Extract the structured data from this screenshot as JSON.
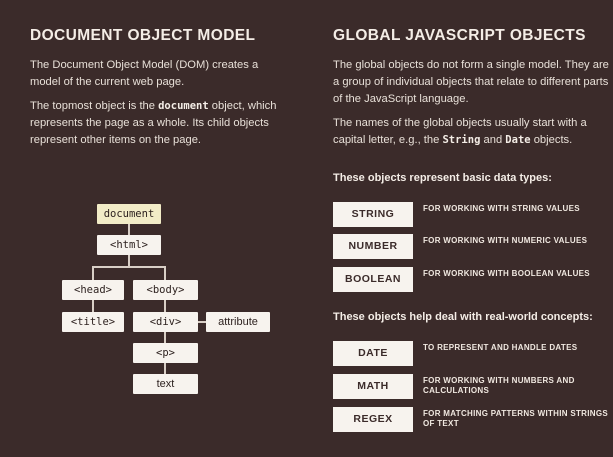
{
  "left": {
    "heading": "DOCUMENT OBJECT MODEL",
    "para1": "The Document Object Model (DOM) creates a model of the current web page.",
    "para2_a": "The topmost object is the ",
    "para2_code": "document",
    "para2_b": " object, which represents the page as a whole. Its child objects represent other items on the page.",
    "tree": {
      "document": "document",
      "html": "<html>",
      "head": "<head>",
      "body": "<body>",
      "title": "<title>",
      "div": "<div>",
      "attribute": "attribute",
      "p": "<p>",
      "text": "text"
    }
  },
  "right": {
    "heading": "GLOBAL JAVASCRIPT OBJECTS",
    "para1": "The global objects do not form a single model. They are a group of individual objects that relate to different parts of the JavaScript language.",
    "para2_a": "The names of the global objects usually start with a capital letter, e.g., the ",
    "para2_code1": "String",
    "para2_mid": " and ",
    "para2_code2": "Date",
    "para2_b": " objects.",
    "basic_heading": "These objects represent basic data types:",
    "basic": [
      {
        "name": "STRING",
        "desc": "FOR WORKING WITH STRING VALUES"
      },
      {
        "name": "NUMBER",
        "desc": "FOR WORKING WITH NUMERIC VALUES"
      },
      {
        "name": "BOOLEAN",
        "desc": "FOR WORKING WITH BOOLEAN VALUES"
      }
    ],
    "real_heading": "These objects help deal with real-world concepts:",
    "real": [
      {
        "name": "DATE",
        "desc": "TO REPRESENT AND HANDLE DATES"
      },
      {
        "name": "MATH",
        "desc": "FOR WORKING WITH NUMBERS AND CALCULATIONS"
      },
      {
        "name": "REGEX",
        "desc": "FOR MATCHING PATTERNS WITHIN STRINGS OF TEXT"
      }
    ]
  },
  "colors": {
    "background": "#3b2b2a",
    "box": "#f7f3ee",
    "root_box": "#f2ecc7",
    "text": "#ece4dc"
  }
}
